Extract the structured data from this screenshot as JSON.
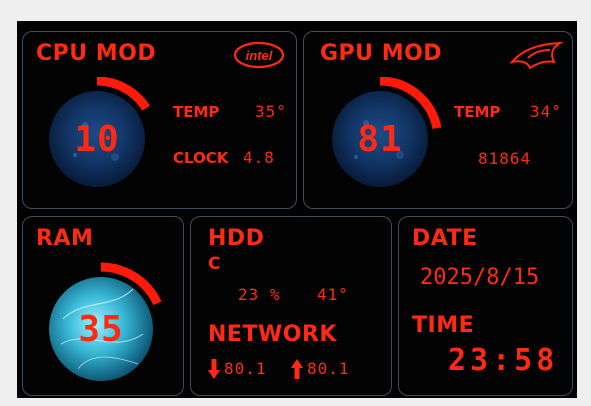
{
  "cpu": {
    "title": "CPU MOD",
    "brand": "intel",
    "usage": "10",
    "usage_fraction": 0.1,
    "temp_label": "TEMP",
    "temp_value": "35°",
    "clock_label": "CLOCK",
    "clock_value": "4.8"
  },
  "gpu": {
    "title": "GPU MOD",
    "brand_icon": "rog-eye-icon",
    "usage": "81",
    "usage_fraction": 0.81,
    "temp_label": "TEMP",
    "temp_value": "34°",
    "extra_value": "81864"
  },
  "ram": {
    "title": "RAM",
    "usage": "35",
    "usage_fraction": 0.35
  },
  "hdd": {
    "title": "HDD",
    "drive": "C",
    "usage": "23 %",
    "temp": "41°"
  },
  "network": {
    "title": "NETWORK",
    "down_icon": "arrow-down-icon",
    "down_value": "80.1",
    "up_icon": "arrow-up-icon",
    "up_value": "80.1"
  },
  "date": {
    "title": "DATE",
    "value": "2025/8/15"
  },
  "time": {
    "title": "TIME",
    "value": "23:58"
  },
  "colors": {
    "accent": "#ff2a14",
    "panel_border": "#3d4e5a",
    "background": "#000000"
  }
}
